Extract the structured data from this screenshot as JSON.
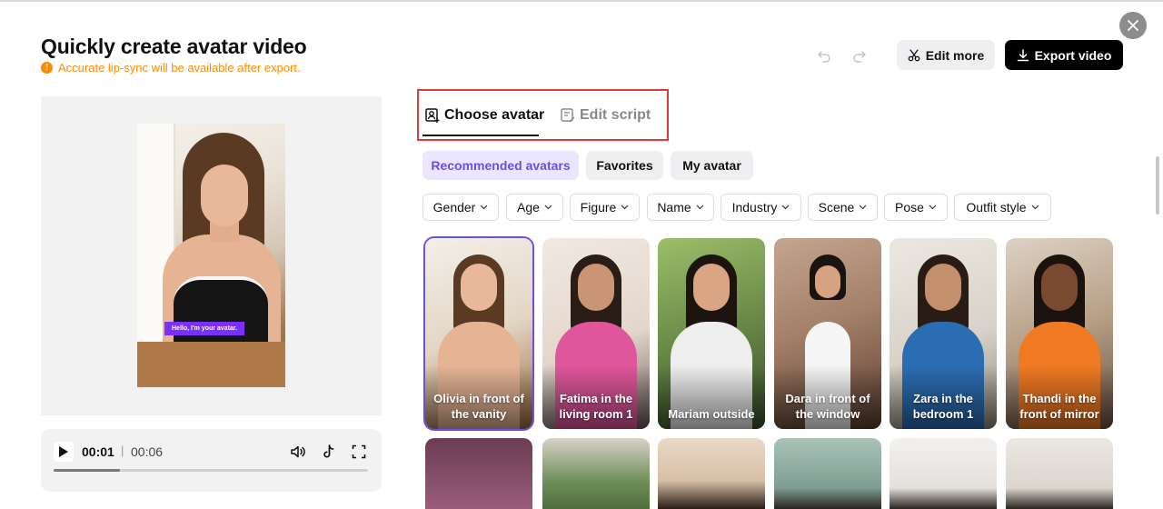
{
  "header": {
    "title": "Quickly create avatar video",
    "notice": "Accurate lip-sync will be available after export.",
    "edit_more_label": "Edit more",
    "export_label": "Export video"
  },
  "preview": {
    "caption": "Hello, I'm your avatar."
  },
  "player": {
    "current_time": "00:01",
    "separator": "|",
    "total_time": "00:06",
    "progress": 0.21
  },
  "tabs": [
    {
      "label": "Choose avatar",
      "active": true
    },
    {
      "label": "Edit script",
      "active": false
    }
  ],
  "categories": [
    {
      "label": "Recommended avatars",
      "active": true
    },
    {
      "label": "Favorites",
      "active": false
    },
    {
      "label": "My avatar",
      "active": false
    }
  ],
  "filters": [
    "Gender",
    "Age",
    "Figure",
    "Name",
    "Industry",
    "Scene",
    "Pose",
    "Outfit style"
  ],
  "avatars": [
    {
      "name": "Olivia in front of the vanity",
      "selected": true
    },
    {
      "name": "Fatima in the living room 1",
      "selected": false
    },
    {
      "name": "Mariam outside",
      "selected": false
    },
    {
      "name": "Dara in front of the window",
      "selected": false
    },
    {
      "name": "Zara in the bedroom 1",
      "selected": false
    },
    {
      "name": "Thandi in the front of mirror",
      "selected": false
    }
  ],
  "colors": {
    "accent": "#6c4fe0",
    "warning": "#ff8a00",
    "highlight_box": "#e53935"
  }
}
